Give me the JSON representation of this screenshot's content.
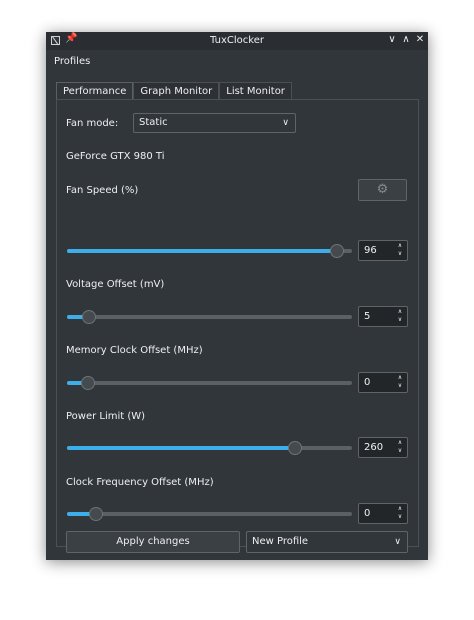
{
  "window": {
    "title": "TuxClocker",
    "pin_glyph": "📌",
    "minimize_glyph": "∨",
    "maximize_glyph": "∧",
    "close_glyph": "✕"
  },
  "menubar": {
    "profiles_label": "Profiles"
  },
  "tabs": [
    {
      "label": "Performance",
      "active": true
    },
    {
      "label": "Graph Monitor",
      "active": false
    },
    {
      "label": "List Monitor",
      "active": false
    }
  ],
  "fan_mode": {
    "label": "Fan mode:",
    "value": "Static",
    "chevron": "∨"
  },
  "gpu_name": "GeForce GTX 980 Ti",
  "gear_glyph": "⚙",
  "spin_arrows": {
    "up": "∧",
    "down": "∨"
  },
  "controls": [
    {
      "label": "Fan Speed (%)",
      "value": "96",
      "fraction": 0.946
    },
    {
      "label": "Voltage Offset (mV)",
      "value": "5",
      "fraction": 0.076
    },
    {
      "label": "Memory Clock Offset (MHz)",
      "value": "0",
      "fraction": 0.073
    },
    {
      "label": "Power Limit (W)",
      "value": "260",
      "fraction": 0.8
    },
    {
      "label": "Clock Frequency Offset (MHz)",
      "value": "0",
      "fraction": 0.101
    }
  ],
  "apply_button": {
    "label": "Apply changes"
  },
  "profile_combo": {
    "value": "New Profile",
    "chevron": "∨"
  },
  "colors": {
    "window_bg": "#31363b",
    "titlebar_bg": "#2a2e32",
    "accent": "#3daee9",
    "groove": "#5b6065",
    "text": "#eff0f1"
  }
}
